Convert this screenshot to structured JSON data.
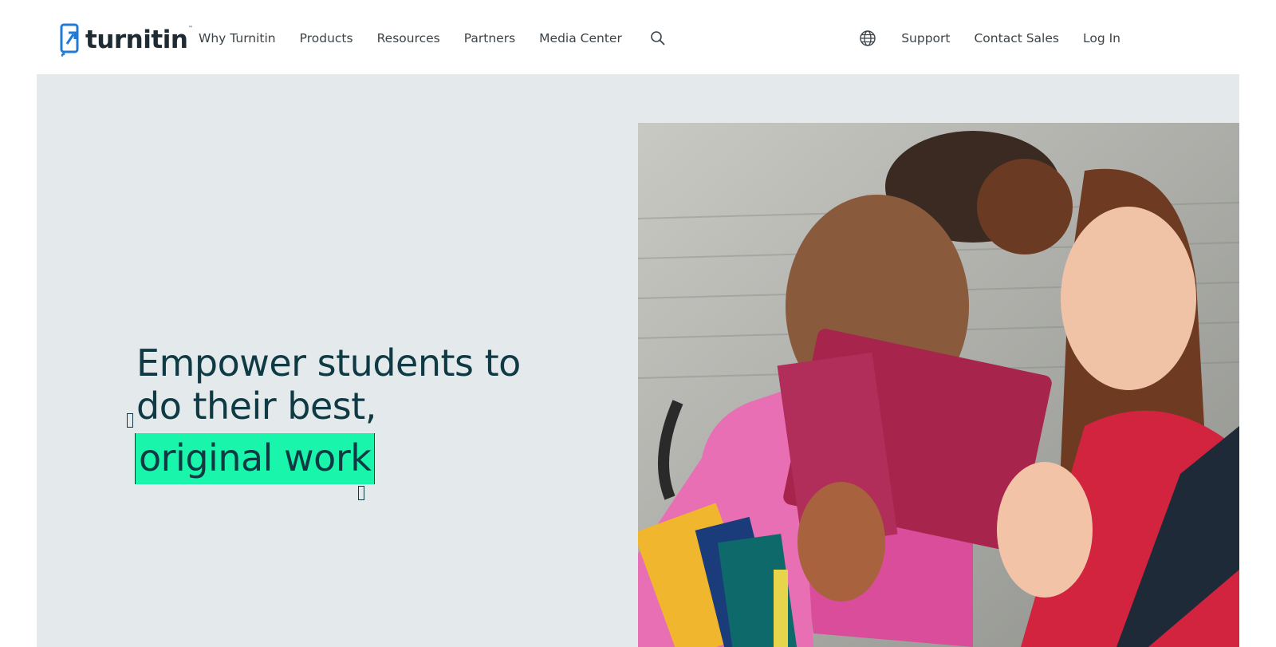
{
  "brand": {
    "name": "turnitin",
    "trademark": "™"
  },
  "nav": {
    "left": [
      "Why Turnitin",
      "Products",
      "Resources",
      "Partners",
      "Media Center"
    ],
    "right": [
      "Support",
      "Contact Sales",
      "Log In"
    ]
  },
  "icons": {
    "search": "search-icon",
    "language": "globe-icon",
    "logo": "turnitin-arrow-logo"
  },
  "hero": {
    "headline_line1": "Empower students to",
    "headline_line2": "do their best,",
    "highlight": "original work"
  },
  "colors": {
    "accent": "#19f5aa",
    "heading": "#0f3a44",
    "hero_bg": "#e4e9eb",
    "logo_blue": "#1f7bd6"
  }
}
